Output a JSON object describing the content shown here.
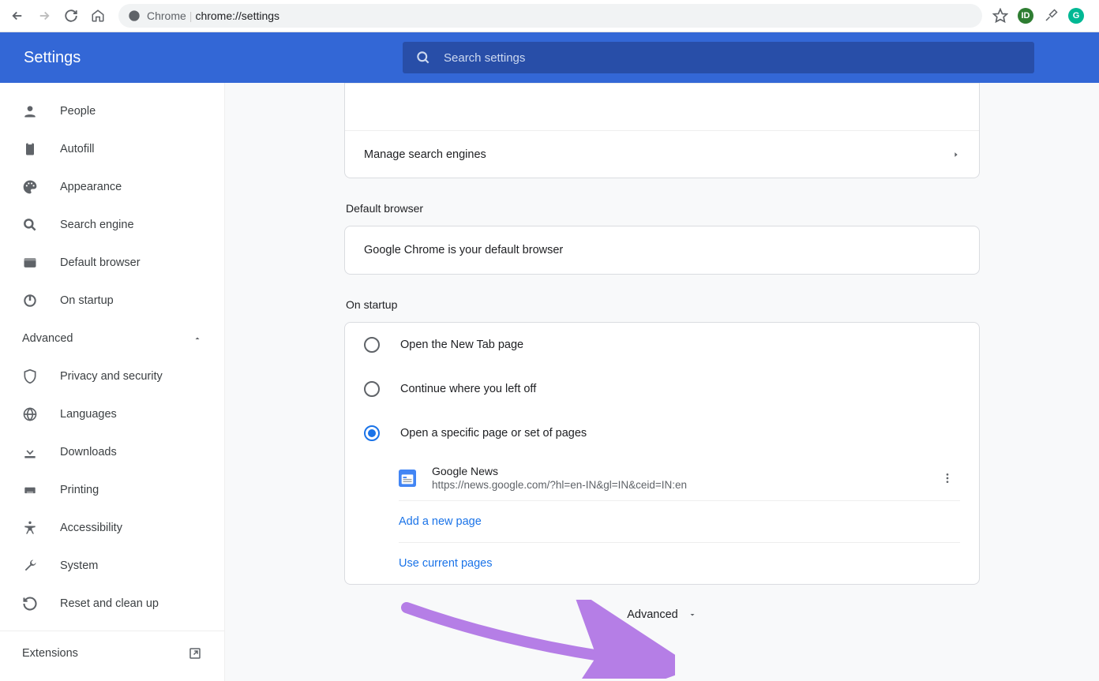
{
  "browser": {
    "url_prefix": "Chrome",
    "url_path": "chrome://settings"
  },
  "header": {
    "title": "Settings",
    "search_placeholder": "Search settings"
  },
  "sidebar": {
    "items": [
      {
        "label": "People"
      },
      {
        "label": "Autofill"
      },
      {
        "label": "Appearance"
      },
      {
        "label": "Search engine"
      },
      {
        "label": "Default browser"
      },
      {
        "label": "On startup"
      }
    ],
    "advanced_label": "Advanced",
    "subitems": [
      {
        "label": "Privacy and security"
      },
      {
        "label": "Languages"
      },
      {
        "label": "Downloads"
      },
      {
        "label": "Printing"
      },
      {
        "label": "Accessibility"
      },
      {
        "label": "System"
      },
      {
        "label": "Reset and clean up"
      }
    ],
    "extensions_label": "Extensions"
  },
  "content": {
    "manage_search_label": "Manage search engines",
    "default_browser_title": "Default browser",
    "default_browser_text": "Google Chrome is your default browser",
    "startup_title": "On startup",
    "startup_options": [
      {
        "label": "Open the New Tab page"
      },
      {
        "label": "Continue where you left off"
      },
      {
        "label": "Open a specific page or set of pages"
      }
    ],
    "startup_page": {
      "name": "Google News",
      "url": "https://news.google.com/?hl=en-IN&gl=IN&ceid=IN:en"
    },
    "add_page_label": "Add a new page",
    "use_current_label": "Use current pages",
    "advanced_footer": "Advanced"
  }
}
